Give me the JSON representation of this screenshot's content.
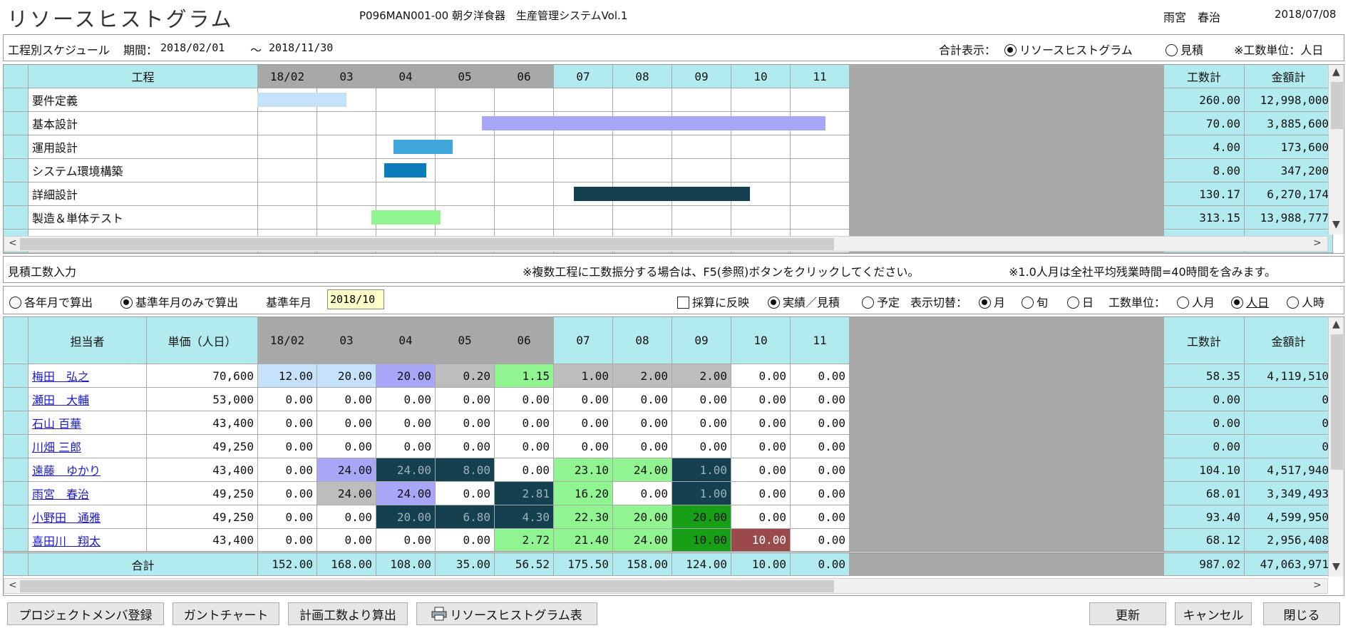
{
  "header": {
    "title": "リソースヒストグラム",
    "program": "P096MAN001-00 朝夕洋食器　生産管理システムVol.1",
    "user": "雨宮　春治",
    "date": "2018/07/08"
  },
  "schedule": {
    "label": "工程別スケジュール",
    "period_label": "期間：",
    "period_from": "2018/02/01",
    "period_sep": "～",
    "period_to": "2018/11/30",
    "total_label": "合計表示：",
    "opt_histogram": "リソースヒストグラム",
    "opt_estimate": "見積",
    "unit_note": "※工数単位：人日"
  },
  "gantt": {
    "col_process": "工程",
    "months": [
      "18/02",
      "03",
      "04",
      "05",
      "06",
      "07",
      "08",
      "09",
      "10",
      "11"
    ],
    "col_hours": "工数計",
    "col_amount": "金額計",
    "rows": [
      {
        "name": "要件定義",
        "hours": "260.00",
        "amount": "12,998,000",
        "start": 0.0,
        "end": 1.5,
        "color": "#c5e2fa"
      },
      {
        "name": "基本設計",
        "hours": "70.00",
        "amount": "3,885,600",
        "start": 3.8,
        "end": 9.6,
        "color": "#a7a6f7"
      },
      {
        "name": "運用設計",
        "hours": "4.00",
        "amount": "173,600",
        "start": 2.3,
        "end": 3.3,
        "color": "#3fa7da"
      },
      {
        "name": "システム環境構築",
        "hours": "8.00",
        "amount": "347,200",
        "start": 2.15,
        "end": 2.85,
        "color": "#0b7cba"
      },
      {
        "name": "詳細設計",
        "hours": "130.17",
        "amount": "6,270,174",
        "start": 5.35,
        "end": 8.33,
        "color": "#14404f"
      },
      {
        "name": "製造＆単体テスト",
        "hours": "313.15",
        "amount": "13,988,777",
        "start": 1.93,
        "end": 3.1,
        "color": "#90f590"
      }
    ]
  },
  "estimate": {
    "label": "見積工数入力",
    "note1": "※複数工程に工数振分する場合は、F5(参照)ボタンをクリックしてください。",
    "note2": "※1.0人月は全社平均残業時間=40時間を含みます。"
  },
  "options": {
    "calc_each": "各年月で算出",
    "calc_base": "基準年月のみで算出",
    "base_label": "基準年月",
    "base_value": "2018/10",
    "reflect": "採算に反映",
    "actual": "実績／見積",
    "plan": "予定",
    "display_label": "表示切替：",
    "month": "月",
    "decade": "旬",
    "day": "日",
    "unit_label": "工数単位：",
    "person_month": "人月",
    "person_day": "人日",
    "person_hour": "人時"
  },
  "staff": {
    "col_person": "担当者",
    "col_rate": "単価（人日）",
    "months": [
      "18/02",
      "03",
      "04",
      "05",
      "06",
      "07",
      "08",
      "09",
      "10",
      "11"
    ],
    "col_hours": "工数計",
    "col_amount": "金額計",
    "rows": [
      {
        "name": "梅田　弘之",
        "rate": "70,600",
        "hours": "58.35",
        "amount": "4,119,510",
        "vals": [
          "12.00",
          "20.00",
          "20.00",
          "0.20",
          "1.15",
          "1.00",
          "2.00",
          "2.00",
          "0.00",
          "0.00"
        ],
        "cls": [
          "lightblue",
          "lightblue",
          "lavender",
          "gray",
          "lime",
          "gray",
          "gray",
          "gray",
          "white",
          "white"
        ]
      },
      {
        "name": "瀬田　大輔",
        "rate": "53,000",
        "hours": "0.00",
        "amount": "0",
        "vals": [
          "0.00",
          "0.00",
          "0.00",
          "0.00",
          "0.00",
          "0.00",
          "0.00",
          "0.00",
          "0.00",
          "0.00"
        ],
        "cls": [
          "white",
          "white",
          "white",
          "white",
          "white",
          "white",
          "white",
          "white",
          "white",
          "white"
        ]
      },
      {
        "name": "石山 百華",
        "rate": "43,400",
        "hours": "0.00",
        "amount": "0",
        "vals": [
          "0.00",
          "0.00",
          "0.00",
          "0.00",
          "0.00",
          "0.00",
          "0.00",
          "0.00",
          "0.00",
          "0.00"
        ],
        "cls": [
          "white",
          "white",
          "white",
          "white",
          "white",
          "white",
          "white",
          "white",
          "white",
          "white"
        ]
      },
      {
        "name": "川畑 三郎",
        "rate": "49,250",
        "hours": "0.00",
        "amount": "0",
        "vals": [
          "0.00",
          "0.00",
          "0.00",
          "0.00",
          "0.00",
          "0.00",
          "0.00",
          "0.00",
          "0.00",
          "0.00"
        ],
        "cls": [
          "white",
          "white",
          "white",
          "white",
          "white",
          "white",
          "white",
          "white",
          "white",
          "white"
        ]
      },
      {
        "name": "遠藤　ゆかり",
        "rate": "43,400",
        "hours": "104.10",
        "amount": "4,517,940",
        "vals": [
          "0.00",
          "24.00",
          "24.00",
          "8.00",
          "0.00",
          "23.10",
          "24.00",
          "1.00",
          "0.00",
          "0.00"
        ],
        "cls": [
          "white",
          "lavender",
          "navy",
          "navy",
          "white",
          "lime",
          "lime",
          "navy",
          "white",
          "white"
        ]
      },
      {
        "name": "雨宮　春治",
        "rate": "49,250",
        "hours": "68.01",
        "amount": "3,349,493",
        "vals": [
          "0.00",
          "24.00",
          "24.00",
          "0.00",
          "2.81",
          "16.20",
          "0.00",
          "1.00",
          "0.00",
          "0.00"
        ],
        "cls": [
          "white",
          "gray",
          "lavender",
          "white",
          "navy",
          "lime",
          "white",
          "navy",
          "white",
          "white"
        ]
      },
      {
        "name": "小野田　通雅",
        "rate": "49,250",
        "hours": "93.40",
        "amount": "4,599,950",
        "vals": [
          "0.00",
          "0.00",
          "20.00",
          "6.80",
          "4.30",
          "22.30",
          "20.00",
          "20.00",
          "0.00",
          "0.00"
        ],
        "cls": [
          "white",
          "white",
          "navy",
          "navy",
          "navy",
          "lime",
          "lime",
          "green",
          "white",
          "white"
        ]
      },
      {
        "name": "喜田川　翔太",
        "rate": "43,400",
        "hours": "68.12",
        "amount": "2,956,408",
        "vals": [
          "0.00",
          "0.00",
          "0.00",
          "0.00",
          "2.72",
          "21.40",
          "24.00",
          "10.00",
          "10.00",
          "0.00"
        ],
        "cls": [
          "white",
          "white",
          "white",
          "white",
          "lime",
          "lime",
          "lime",
          "green",
          "brown",
          "white"
        ]
      }
    ],
    "total": {
      "label": "合計",
      "vals": [
        "152.00",
        "168.00",
        "108.00",
        "35.00",
        "56.52",
        "175.50",
        "158.00",
        "124.00",
        "10.00",
        "0.00"
      ],
      "hours": "987.02",
      "amount": "47,063,971"
    }
  },
  "buttons": {
    "member": "プロジェクトメンバ登録",
    "gantt": "ガントチャート",
    "calc": "計画工数より算出",
    "print": "リソースヒストグラム表",
    "update": "更新",
    "cancel": "キャンセル",
    "close": "閉じる"
  },
  "icons": {
    "scroll_up": "▲",
    "scroll_down": "▼",
    "scroll_left": "<",
    "scroll_right": ">",
    "printer": "printer-icon"
  }
}
